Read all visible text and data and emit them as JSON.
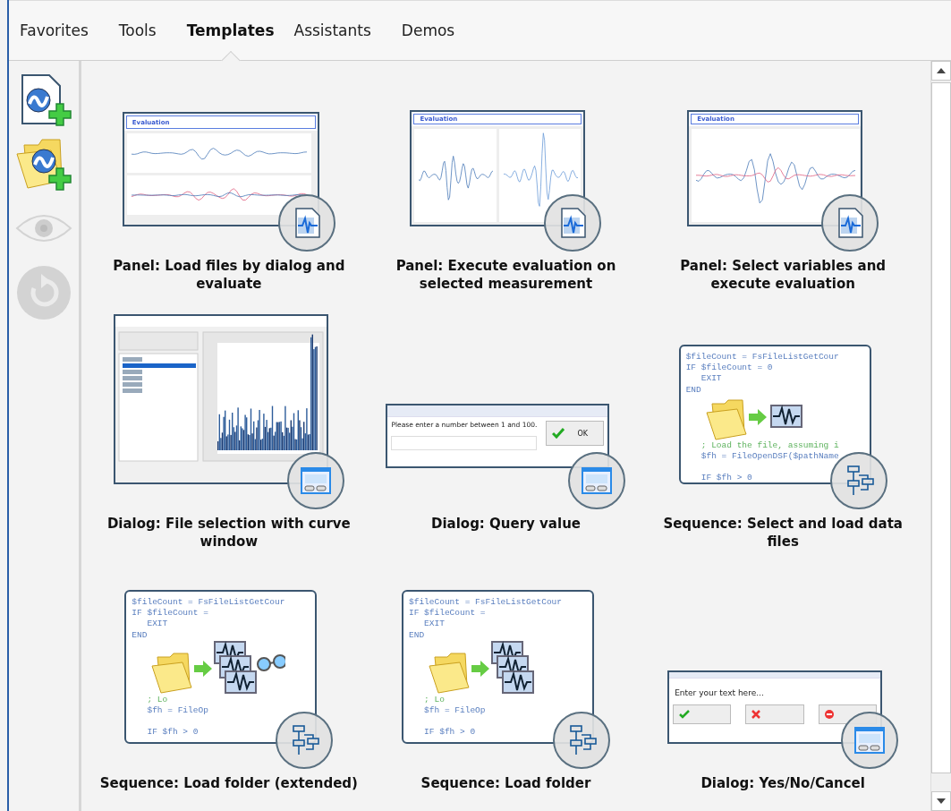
{
  "tabs": [
    {
      "label": "Favorites",
      "selected": false
    },
    {
      "label": "Tools",
      "selected": false
    },
    {
      "label": "Templates",
      "selected": true
    },
    {
      "label": "Assistants",
      "selected": false
    },
    {
      "label": "Demos",
      "selected": false
    }
  ],
  "toolbar": [
    {
      "kind": "new-file",
      "disabled": false
    },
    {
      "kind": "new-folder",
      "disabled": false
    },
    {
      "kind": "view",
      "disabled": true
    },
    {
      "kind": "refresh",
      "disabled": true
    }
  ],
  "templates": [
    {
      "title": "Panel: Load files by dialog and evaluate",
      "thumbnail": {
        "kind": "panel-stacked",
        "title": "Evaluation"
      }
    },
    {
      "title": "Panel: Execute evaluation on selected measurement",
      "thumbnail": {
        "kind": "panel-side",
        "title": "Evaluation"
      }
    },
    {
      "title": "Panel: Select variables and execute evaluation",
      "thumbnail": {
        "kind": "panel-single",
        "title": "Evaluation"
      }
    },
    {
      "title": "Dialog: File selection with curve window",
      "thumbnail": {
        "kind": "file-dialog"
      }
    },
    {
      "title": "Dialog: Query value",
      "thumbnail": {
        "kind": "query",
        "prompt": "Please enter a number between 1 and 100.",
        "button": "OK"
      }
    },
    {
      "title": "Sequence: Select and load data files",
      "thumbnail": {
        "kind": "sequence-single",
        "top_lines": [
          {
            "kind": "code",
            "text": "$fileCount = FsFileListGetCour"
          },
          {
            "kind": "code",
            "text": "IF $fileCount = 0"
          },
          {
            "kind": "code",
            "text": "   EXIT"
          },
          {
            "kind": "code",
            "text": "END"
          }
        ],
        "bottom_lines": [
          {
            "kind": "comment",
            "text": "   ; Load the file, assuming i"
          },
          {
            "kind": "code",
            "text": "   $fh = FileOpenDSF($pathName"
          },
          {
            "kind": "code-spaced",
            "text": "   IF $fh > 0"
          }
        ]
      }
    },
    {
      "title": "Sequence: Load folder (extended)",
      "thumbnail": {
        "kind": "sequence-multi-glasses",
        "top_lines": [
          {
            "kind": "code",
            "text": "$fileCount = FsFileListGetCour"
          },
          {
            "kind": "code",
            "text": "IF $fileCount ="
          },
          {
            "kind": "code",
            "text": "   EXIT"
          },
          {
            "kind": "code",
            "text": "END"
          }
        ],
        "bottom_lines": [
          {
            "kind": "comment",
            "text": "   ; Lo"
          },
          {
            "kind": "code",
            "text": "   $fh = FileOp"
          },
          {
            "kind": "code-spaced",
            "text": "   IF $fh > 0"
          }
        ]
      }
    },
    {
      "title": "Sequence: Load folder",
      "thumbnail": {
        "kind": "sequence-multi",
        "top_lines": [
          {
            "kind": "code",
            "text": "$fileCount = FsFileListGetCour"
          },
          {
            "kind": "code",
            "text": "IF $fileCount ="
          },
          {
            "kind": "code",
            "text": "   EXIT"
          },
          {
            "kind": "code",
            "text": "END"
          }
        ],
        "bottom_lines": [
          {
            "kind": "comment",
            "text": "   ; Lo"
          },
          {
            "kind": "code",
            "text": "   $fh = FileOp"
          },
          {
            "kind": "code-spaced",
            "text": "   IF $fh > 0"
          }
        ]
      }
    },
    {
      "title": "Dialog: Yes/No/Cancel",
      "thumbnail": {
        "kind": "message",
        "prompt": "Enter your text here..."
      }
    }
  ]
}
